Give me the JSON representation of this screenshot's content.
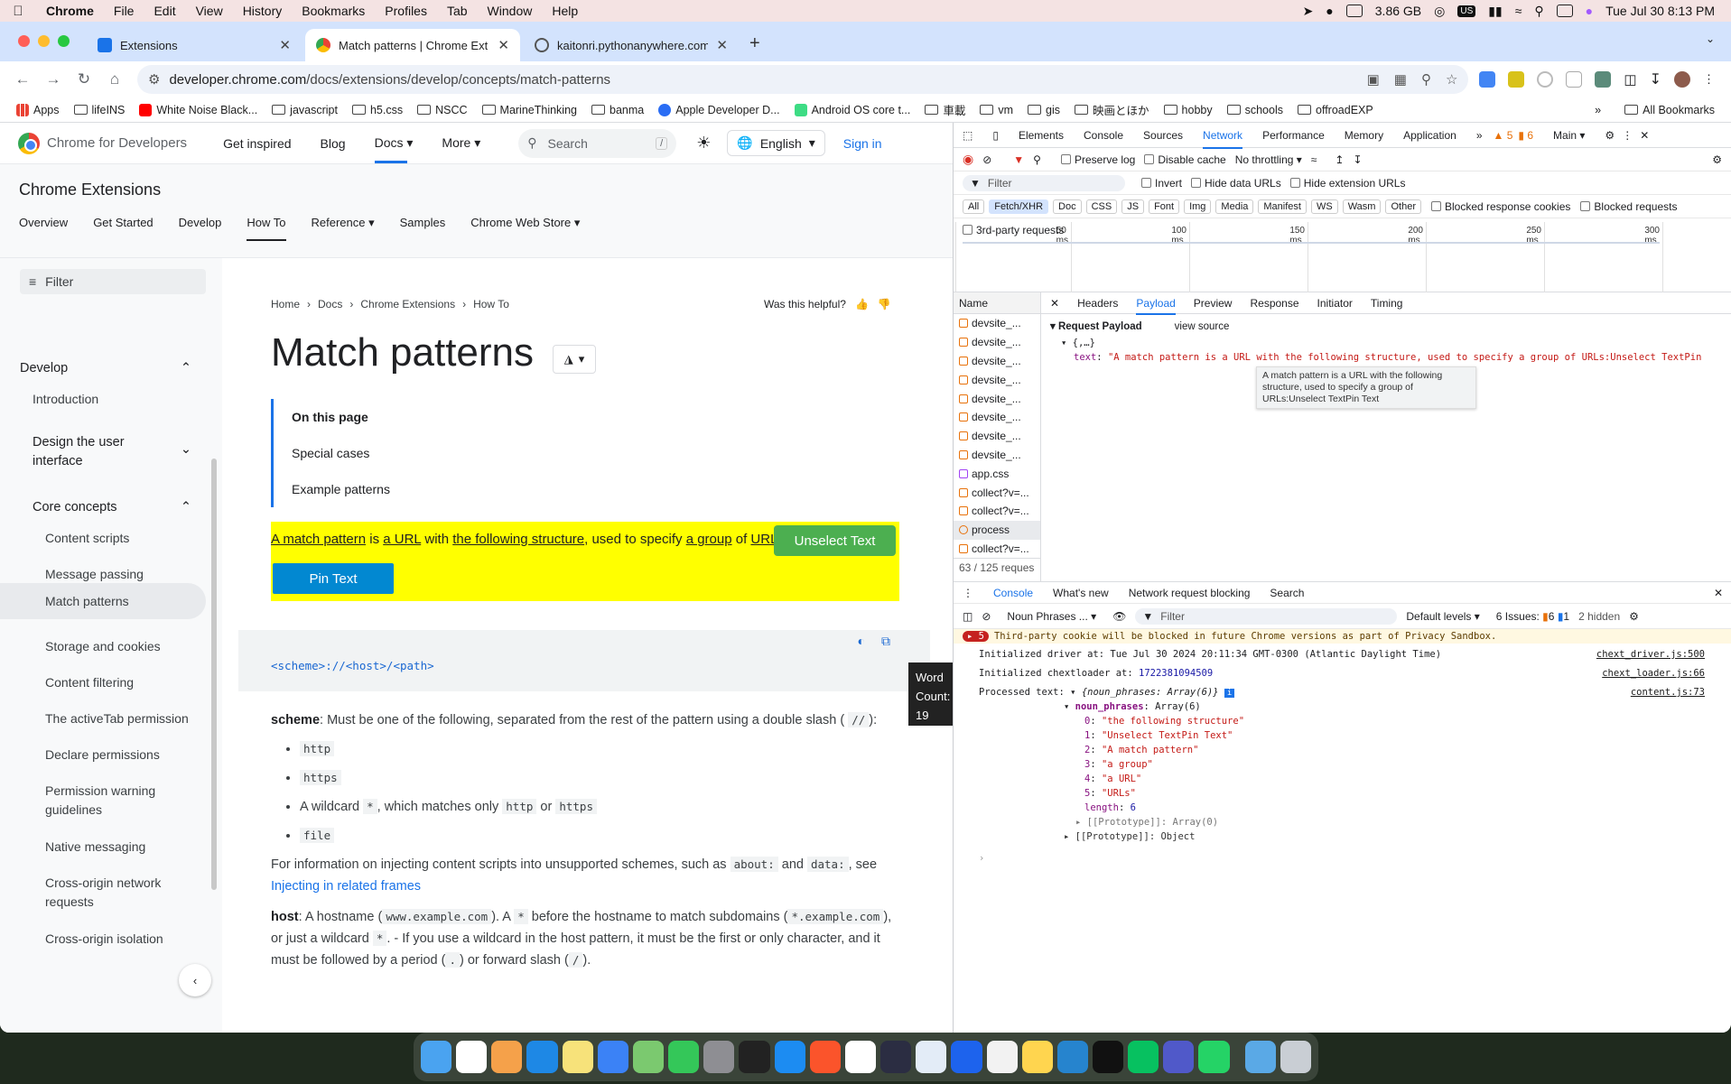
{
  "menubar": {
    "app": "Chrome",
    "items": [
      "File",
      "Edit",
      "View",
      "History",
      "Bookmarks",
      "Profiles",
      "Tab",
      "Window",
      "Help"
    ],
    "memory": "3.86 GB",
    "datetime": "Tue Jul 30  8:13 PM"
  },
  "tabs": [
    {
      "label": "Extensions"
    },
    {
      "label": "Match patterns  |  Chrome Ext"
    },
    {
      "label": "kaitonri.pythonanywhere.com"
    }
  ],
  "omnibox": {
    "domain": "developer.chrome.com",
    "path": "/docs/extensions/develop/concepts/match-patterns"
  },
  "bookmarks": [
    "Apps",
    "lifeINS",
    "White Noise Black...",
    "javascript",
    "h5.css",
    "NSCC",
    "MarineThinking",
    "banma",
    "Apple Developer D...",
    "Android OS core t...",
    "車載",
    "vm",
    "gis",
    "映画とほか",
    "hobby",
    "schools",
    "offroadEXP"
  ],
  "all_bookmarks": "All Bookmarks",
  "site": {
    "name": "Chrome for Developers",
    "nav": [
      "Get inspired",
      "Blog",
      "Docs",
      "More"
    ],
    "search": "Search",
    "slash": "/",
    "lang": "English",
    "signin": "Sign in"
  },
  "section": {
    "title": "Chrome Extensions",
    "tabs": [
      "Overview",
      "Get Started",
      "Develop",
      "How To",
      "Reference",
      "Samples",
      "Chrome Web Store"
    ]
  },
  "leftnav": {
    "filter": "Filter",
    "develop": "Develop",
    "introduction": "Introduction",
    "design": "Design the user interface",
    "core": "Core concepts",
    "items": [
      "Content scripts",
      "Message passing",
      "Match patterns",
      "Storage and cookies",
      "Content filtering",
      "The activeTab permission",
      "Declare permissions",
      "Permission warning guidelines",
      "Native messaging",
      "Cross-origin network requests",
      "Cross-origin isolation"
    ]
  },
  "article": {
    "crumbs": [
      "Home",
      "Docs",
      "Chrome Extensions",
      "How To"
    ],
    "helpful": "Was this helpful?",
    "title": "Match patterns",
    "toc_title": "On this page",
    "toc": [
      "Special cases",
      "Example patterns"
    ],
    "hl": {
      "p1": "A match pattern",
      "p2": " is ",
      "p3": "a URL",
      "p4": " with ",
      "p5": "the following structure",
      "p6": ", used to specify ",
      "p7": "a group",
      "p8": " of ",
      "p9": "URLs",
      "p10": ":"
    },
    "unselect": "Unselect Text",
    "pin": "Pin Text",
    "wordcount": {
      "label1": "Word",
      "label2": "Count:",
      "value": "19"
    },
    "code": "<scheme>://<host>/<path>",
    "scheme_lbl": "scheme",
    "scheme_txt": ": Must be one of the following, separated from the rest of the pattern using a double slash (",
    "dslash": "//",
    "close": "):",
    "list": [
      "http",
      "https",
      "file"
    ],
    "wild1": "A wildcard ",
    "star": "*",
    "wild2": ", which matches only ",
    "or": " or ",
    "info1": "For information on injecting content scripts into unsupported schemes, such as ",
    "about": "about:",
    "and": " and ",
    "data": "data:",
    "see": ", see ",
    "link": "Injecting in related frames",
    ".": ".",
    "host_lbl": "host",
    "host1": ": A hostname (",
    "hostex": "www.example.com",
    "host2": "). A ",
    "host3": " before the hostname to match subdomains (",
    "subex": "*.example.com",
    "host4": "), or just a wildcard ",
    "host5": ". - If you use a wildcard in the host pattern, it must be the first or only character, and it must be followed by a period (",
    "dot": ".",
    "host6": ") or forward slash (",
    "sl": "/",
    "host7": ")."
  },
  "devtools": {
    "tabs": [
      "Elements",
      "Console",
      "Sources",
      "Network",
      "Performance",
      "Memory",
      "Application"
    ],
    "warn": "5",
    "issues": "6",
    "main": "Main",
    "opts": {
      "preserve": "Preserve log",
      "disable": "Disable cache",
      "throttle": "No throttling"
    },
    "filter": "Filter",
    "invert": "Invert",
    "hidedata": "Hide data URLs",
    "hideext": "Hide extension URLs",
    "types": [
      "All",
      "Fetch/XHR",
      "Doc",
      "CSS",
      "JS",
      "Font",
      "Img",
      "Media",
      "Manifest",
      "WS",
      "Wasm",
      "Other"
    ],
    "blockedcookies": "Blocked response cookies",
    "blockedreq": "Blocked requests",
    "third": "3rd-party requests",
    "ticks": [
      "50 ms",
      "100 ms",
      "150 ms",
      "200 ms",
      "250 ms",
      "300 ms"
    ],
    "name": "Name",
    "requests": [
      "devsite_...",
      "devsite_...",
      "devsite_...",
      "devsite_...",
      "devsite_...",
      "devsite_...",
      "devsite_...",
      "devsite_...",
      "app.css",
      "collect?v=...",
      "collect?v=...",
      "process",
      "collect?v=..."
    ],
    "reqcount": "63 / 125 reques",
    "dtabs": [
      "Headers",
      "Payload",
      "Preview",
      "Response",
      "Initiator",
      "Timing"
    ],
    "payload": {
      "title": "Request Payload",
      "view": "view source",
      "obj": "{,…}",
      "key": "text",
      "val": "\"A match pattern is a URL with the following structure, used to specify a group of URLs:Unselect TextPin"
    },
    "tooltip": "A match pattern is a URL with the following structure, used to specify a group of URLs:Unselect TextPin Text",
    "drawer": {
      "tabs": [
        "Console",
        "What's new",
        "Network request blocking",
        "Search"
      ],
      "context": "Noun Phrases ...",
      "filter": "Filter",
      "levels": "Default levels",
      "issues": "6 Issues:",
      "i6": "6",
      "i1": "1",
      "hidden": "2 hidden"
    },
    "console": {
      "warncount": "5",
      "warn": "Third-party cookie will be blocked in future Chrome versions as part of Privacy Sandbox.",
      "l1": "Initialized driver at: Tue Jul 30 2024 20:11:34 GMT-0300 (Atlantic Daylight Time)",
      "s1": "chext_driver.js:500",
      "l2a": "Initialized chextloader at: ",
      "l2b": "1722381094509",
      "s2": "chext_loader.js:66",
      "l3a": "Processed text: ",
      "l3b": "{noun_phrases: Array(6)}",
      "s3": "content.js:73",
      "np": "noun_phrases",
      "arr": "Array(6)",
      "items": [
        "\"the following structure\"",
        "\"Unselect TextPin Text\"",
        "\"A match pattern\"",
        "\"a group\"",
        "\"a URL\"",
        "\"URLs\""
      ],
      "len": "6",
      "proto1": "[[Prototype]]: Array(0)",
      "proto2": "[[Prototype]]: Object"
    }
  }
}
